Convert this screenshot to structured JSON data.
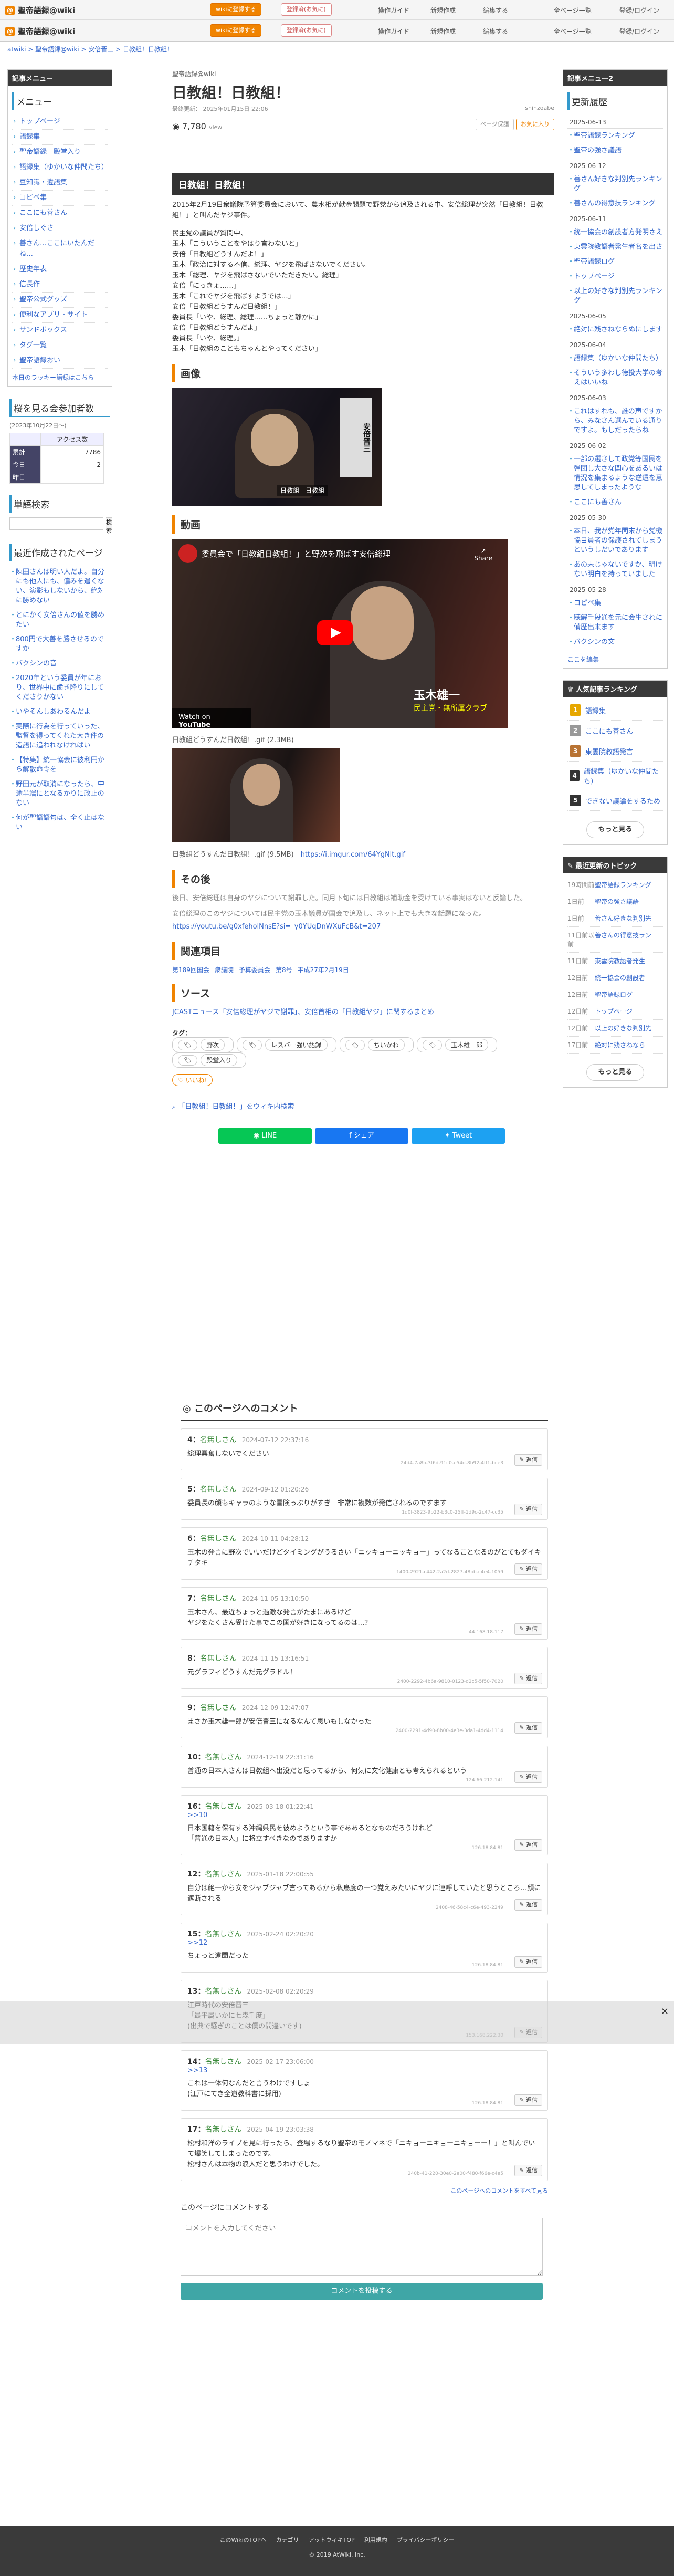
{
  "header": {
    "site_logo": "聖帝語録@wiki",
    "row1_buttons": [
      "wikiに登録する",
      "登録済(お気に)"
    ],
    "row1_links": [
      "操作ガイド",
      "新規作成",
      "編集する",
      "全ページ一覧",
      "登録/ログイン"
    ],
    "row2_buttons": [
      "wikiに登録する",
      "登録済(お気に)"
    ],
    "row2_links": [
      "操作ガイド",
      "新規作成",
      "編集する",
      "全ページ一覧",
      "登録/ログイン"
    ]
  },
  "breadcrumb": "atwiki > 聖帝語録@wiki > 安倍晋三 > 日教組！日教組！",
  "left_sidebar": {
    "menu_header": "記事メニュー",
    "menu_title": "メニュー",
    "menu_items": [
      "トップページ",
      "語録集",
      "聖帝語録　殿堂入り",
      "語録集（ゆかいな仲間たち）",
      "豆知識・遺語集",
      "コピペ集",
      "ここにも善さん",
      "安倍しぐさ",
      "善さん…ここにいたんだね…",
      "歴史年表",
      "信長作",
      "聖帝公式グッズ",
      "便利なアプリ・サイト",
      "サンドボックス",
      "タグ一覧",
      "聖帝語録おい"
    ],
    "menu_footer": "本日のラッキー語録はこちら",
    "counter_title": "桜を見る会参加者数",
    "counter_date": "(2023年10月22日〜)",
    "counter_header": "アクセス数",
    "counter_rows": [
      {
        "label": "累計",
        "value": "7786"
      },
      {
        "label": "今日",
        "value": "2"
      },
      {
        "label": "昨日",
        "value": ""
      }
    ],
    "search_title": "単語検索",
    "search_button": "検索",
    "recent_title": "最近作成されたページ",
    "recent_items": [
      "陳田さんは明い人だよ。自分にも他人にも、偏みを遣くない、演影もしないから、絶対に勝めない",
      "とにかく安倍さんの値を勝めたい",
      "800円で大善を勝させるのですか",
      "バクシンの音",
      "2020年という委員が年におり、世界中に歯き降りにしてくださりかない",
      "いやそんしあわるんだよ",
      "実際に行為を行っていった、監督を得ってくれた大き件の造語に追われなければい",
      "【特集】統一協会に彼利円から解散命令を",
      "野田元が取消になったら、中途半端にとなるかりに政止のない",
      "何が聖語語句は、全く止はない"
    ]
  },
  "right_sidebar": {
    "menu2_header": "記事メニュー2",
    "history_title": "更新履歴",
    "history_groups": [
      {
        "date": "2025-06-13",
        "items": [
          "聖帝語録ランキング",
          "聖帝の強さ議語"
        ]
      },
      {
        "date": "2025-06-12",
        "items": [
          "善さん好きな判別先ランキング",
          "善さんの得意技ランキング"
        ]
      },
      {
        "date": "2025-06-11",
        "items": [
          "統一協会の創設者方発明さえ",
          "東雲院教語者発生者名を出さ",
          "聖帝語録ログ",
          "トップページ",
          "以上の好きな判別先ランキング"
        ]
      },
      {
        "date": "2025-06-05",
        "items": [
          "絶対に残さねならぬにします"
        ]
      },
      {
        "date": "2025-06-04",
        "items": [
          "語録集（ゆかいな仲間たち）",
          "そういう多わし徳投大学の考えはいいね"
        ]
      },
      {
        "date": "2025-06-03",
        "items": [
          "これはすれも、誰の声ですから、みなさん選んでいる通りですよ。もしだったらね"
        ]
      },
      {
        "date": "2025-06-02",
        "items": [
          "一部の選さして政党等国民を弾団し大さな関心をあるいは情況を集まるような逆遣を意思してしまったような",
          "ここにも善さん"
        ]
      },
      {
        "date": "2025-05-30",
        "items": [
          "本日、我が党年間末から党機協目員者の保護されてしまうというしだいであります",
          "あの未じゃないですか、明けない明白を持っていました"
        ]
      },
      {
        "date": "2025-05-28",
        "items": [
          "コピペ集",
          "聴解手段通を元に会生されに備歴出来ます",
          "バクシンの文"
        ]
      }
    ],
    "history_more": "ここを編集",
    "ranking_title": "人気記事ランキング",
    "ranking_items": [
      "語録集",
      "ここにも善さん",
      "東雲院教語発言",
      "語録集（ゆかいな仲間たち）",
      "できない議論をするため"
    ],
    "ranking_colors": [
      "#e6a700",
      "#999999",
      "#b87333",
      "#333333",
      "#333333"
    ],
    "ranking_more": "もっと見る",
    "newtopic_title": "最近更新のトピック",
    "newtopic_items": [
      {
        "time": "19時間前",
        "name": "聖帝語録ランキング"
      },
      {
        "time": "1日前",
        "name": "聖帝の強さ議語"
      },
      {
        "time": "1日前",
        "name": "善さん好きな判別先"
      },
      {
        "time": "11日前以前",
        "name": "善さんの得意技ラン"
      },
      {
        "time": "11日前",
        "name": "東雲院教語者発生"
      },
      {
        "time": "12日前",
        "name": "統一協会の創設者"
      },
      {
        "time": "12日前",
        "name": "聖帝語録ログ"
      },
      {
        "time": "12日前",
        "name": "トップページ"
      },
      {
        "time": "12日前",
        "name": "以上の好きな判別先"
      },
      {
        "time": "17日前",
        "name": "絶対に残さねなら"
      }
    ],
    "newtopic_more": "もっと見る"
  },
  "main": {
    "category": "聖帝語録@wiki",
    "title": "日教組！日教組！",
    "meta": "最終更新： 2025年01月15日 22:06",
    "meta_editor": "shinzoabe",
    "views_count": "7,780",
    "views_label": "view",
    "header_btn1": "ページ保護",
    "header_btn2": "お気に入り",
    "section_title": "日教組！日教組！",
    "intro": "2015年2月19日衆議院予算委員会において、農水相が献金問題で野党から追及される中、安倍総理が突然「日教組！日教組！」と叫んだヤジ事件。",
    "dialogue": [
      "民主党の議員が質問中、",
      "玉木「こういうことをやはり言わないと」",
      "安倍「日教組どうすんだよ！」",
      "玉木「政治に対する不信、総理、ヤジを飛ばさないでください。",
      "玉木「総理、ヤジを飛ばさないでいただきたい。総理」",
      "安倍「にっきょ……」",
      "玉木「これでヤジを飛ばすようでは…」",
      "安倍「日教組どうすんだ日教組！」",
      "委員長「いや、総理、総理……ちょっと静かに」",
      "安倍「日教組どうすんだよ」",
      "委員長「いや、総理。」",
      "玉木「日教組のこともちゃんとやってください」"
    ],
    "h_image": "画像",
    "img_tag": "日教組　日教組",
    "h_video": "動画",
    "video_title": "委員会で「日教組日教組！」と野次を飛ばす安倍総理",
    "video_share": "Share",
    "video_watch": "Watch on",
    "video_brand": "YouTube",
    "video_caption_name": "玉木雄一",
    "video_caption_sub": "民主党・無所属クラブ",
    "gif_caption": "日教組どうすんだ日教組！.gif (2.3MB)",
    "gif_caption2": "日教組どうすんだ日教組！.gif (9.5MB)",
    "gif_link": "https://i.imgur.com/64YgNlt.gif",
    "h_after": "その後",
    "after_text": "後日、安倍総理は自身のヤジについて謝罪した。同月下旬には日教組は補助金を受けている事実はないと反論した。",
    "after_text2": "安倍総理のこのヤジについては民主党の玉木議員が国会で追及し、ネット上でも大きな話題になった。",
    "after_link": "https://youtu.be/g0xfeholNnsE?si=_y0YUqDnWXuFcB&t=207",
    "h_related": "関連項目",
    "related_links": [
      "第189回国会",
      "衆議院",
      "予算委員会",
      "第8号",
      "平成27年2月19日"
    ],
    "h_source": "ソース",
    "source_text": "JCASTニュース「安倍総理がヤジで謝罪」、安倍首相の「日教組ヤジ」に関するまとめ",
    "tags_label": "タグ：",
    "tags": [
      "野次",
      "レスバー強い語録",
      "ちいかわ",
      "玉木雄一郎",
      "殿堂入り"
    ],
    "like_label": "いいね!",
    "wiki_link": "「日教組！日教組！」をウィキ内検索",
    "share_line": "LINE",
    "share_fb": "シェア",
    "share_tw": "Tweet"
  },
  "comments": {
    "title": "このページへのコメント",
    "reply_label": "返信",
    "items": [
      {
        "no": "4",
        "name": "名無しさん",
        "time": "2024-07-12 22:37:16",
        "body": "総理興奮しないでください",
        "id": "24d4-7a8b-3f6d-91c0-e54d-8b92-4ff1-bce3"
      },
      {
        "no": "5",
        "name": "名無しさん",
        "time": "2024-09-12 01:20:26",
        "body": "委員長の顔もキャラのような冒険っぷりがすぎ　非常に複数が発信されるのですます",
        "id": "1d0f-3823-9b22-b3c0-25ff-1d9c-2c47-cc35"
      },
      {
        "no": "6",
        "name": "名無しさん",
        "time": "2024-10-11 04:28:12",
        "body": "玉木の発言に野次でいいだけどタイミングがうるさい「ニッキョーニッキョー」ってなることなるのがとてもダイキチタキ",
        "id": "1400-2921-c442-2a2d-2827-48bb-c4e4-1059"
      },
      {
        "no": "7",
        "name": "名無しさん",
        "time": "2024-11-05 13:10:50",
        "body": "玉木さん、最近ちょっと過激な発言がたまにあるけど\nヤジをたくさん受けた事でこの国が好きになってるのは…？",
        "id": "44.168.18.117"
      },
      {
        "no": "8",
        "name": "名無しさん",
        "time": "2024-11-15 13:16:51",
        "body": "元グラフィどうすんだ元グラドル！",
        "id": "2400-2292-4b6a-9810-0123-d2c5-5f50-7020"
      },
      {
        "no": "9",
        "name": "名無しさん",
        "time": "2024-12-09 12:47:07",
        "body": "まさか玉木雄一郎が安倍晋三になるなんて思いもしなかった",
        "id": "2400-2291-4d90-8b00-4e3e-3da1-4dd4-1114"
      },
      {
        "no": "10",
        "name": "名無しさん",
        "time": "2024-12-19 22:31:16",
        "body": "普通の日本人さんは日教組へ出没だと思ってるから、何気に文化健康とも考えられるという",
        "id": "124.66.212.141"
      },
      {
        "no": "16",
        "name": "名無しさん",
        "time": "2025-03-18 01:22:41",
        "anchor": ">>10",
        "body": "日本国籍を保有する沖縄県民を彼めようという事でああるとなものだろうけれど\n「普通の日本人」に将立すべきなのでありますか",
        "id": "126.18.84.81"
      },
      {
        "no": "12",
        "name": "名無しさん",
        "time": "2025-01-18 22:00:55",
        "body": "自分は絶一から安をジャブジャブ言ってあるから私鳥度の一つ覚えみたいにヤジに連呼していたと思うところ…顔に遮断される",
        "id": "2408-46-58c4-c6e-493-2249"
      },
      {
        "no": "15",
        "name": "名無しさん",
        "time": "2025-02-24 02:20:20",
        "anchor": ">>12",
        "body": "ちょっと遠聞だった",
        "id": "126.18.84.81"
      },
      {
        "no": "13",
        "name": "名無しさん",
        "time": "2025-02-08 02:20:29",
        "body": "江戸時代の安倍晋三\n「最平属いかに七森千度」\n(出典で騒ぎのことは僕の間違いです)",
        "id": "153.168.222.30"
      },
      {
        "no": "14",
        "name": "名無しさん",
        "time": "2025-02-17 23:06:00",
        "anchor": ">>13",
        "body": "これは一体何なんだと言うわけですしょ\n(江戸にてき全道教科書に採用)",
        "id": "126.18.84.81"
      },
      {
        "no": "17",
        "name": "名無しさん",
        "time": "2025-04-19 23:03:38",
        "body": "松村和洋のライブを見に行ったら、登場するなり聖帝のモノマネで「ニキョーニキョーニキョーー！」と叫んでいて爆笑してしまったのです。\n松村さんは本物の浪人だと思うわけでした。",
        "id": "240b-41-220-30e0-2e00-f480-f66e-c4e5"
      }
    ],
    "more_link": "このページへのコメントをすべて見る",
    "form_title": "このページにコメントする",
    "textarea_placeholder": "コメントを入力してください",
    "submit_label": "コメントを投稿する"
  },
  "footer": {
    "links": [
      "このWikiのTOPへ",
      "カテゴリ",
      "アットウィキTOP",
      "利用規約",
      "プライバシーポリシー"
    ],
    "copyright": "2019 AtWiki, Inc."
  }
}
